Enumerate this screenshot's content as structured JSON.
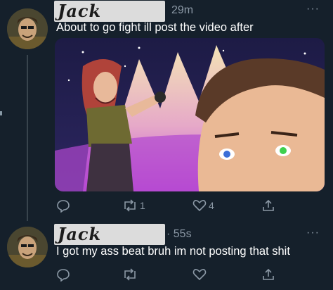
{
  "tweets": [
    {
      "author": "Jack",
      "time": "29m",
      "more": "···",
      "text": "About to go fight ill post the video after",
      "actions": {
        "reply_count": "",
        "retweet_count": "1",
        "like_count": "4"
      }
    },
    {
      "author": "Jack",
      "time": "· 55s",
      "more": "···",
      "text": "I got my ass beat bruh im not posting that shit",
      "actions": {
        "reply_count": "",
        "retweet_count": "",
        "like_count": ""
      }
    }
  ],
  "colors": {
    "background": "#15202b",
    "text": "#ffffff",
    "muted": "#8b98a5"
  }
}
